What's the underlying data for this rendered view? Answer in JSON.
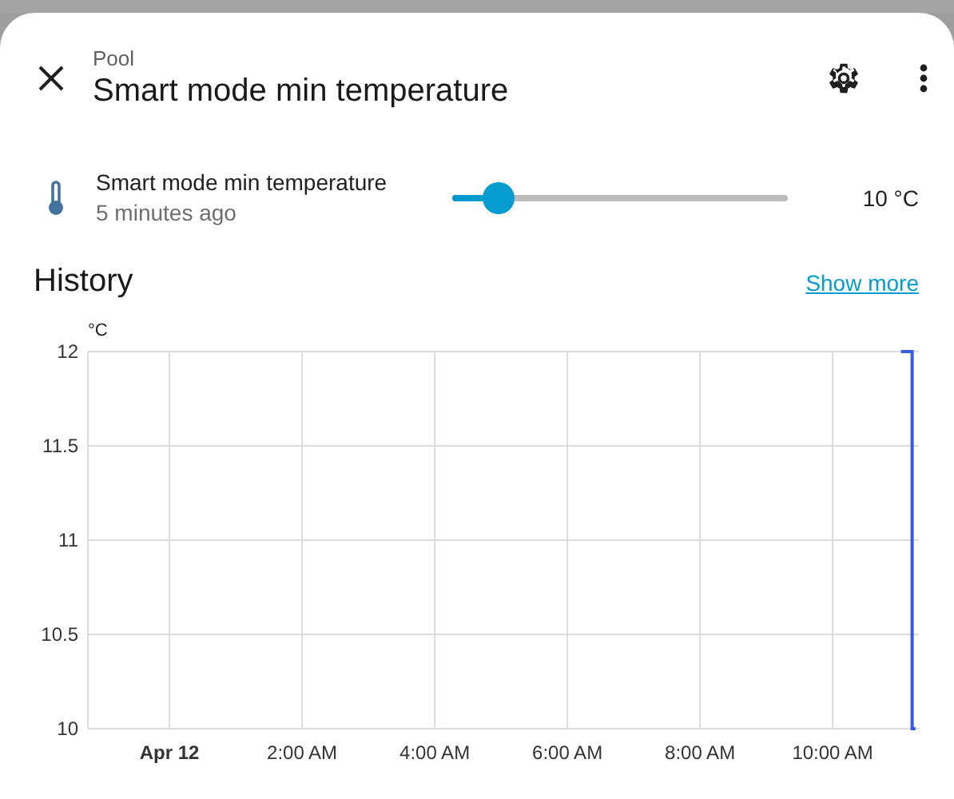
{
  "dialog": {
    "breadcrumb": "Pool",
    "title": "Smart mode min temperature"
  },
  "entity": {
    "name": "Smart mode min temperature",
    "last_changed": "5 minutes ago",
    "level": 0.14,
    "reading": "10 °C"
  },
  "history": {
    "title": "History",
    "link": "Show more",
    "chart_data": {
      "type": "line",
      "ylabel": "°C",
      "xlim": [
        -1.23,
        11.3
      ],
      "ylim": [
        10,
        12
      ],
      "xticks": [
        {
          "value": 0,
          "label": "Apr 12"
        },
        {
          "value": 2,
          "label": "2:00 AM"
        },
        {
          "value": 4,
          "label": "4:00 AM"
        },
        {
          "value": 6,
          "label": "6:00 AM"
        },
        {
          "value": 8,
          "label": "8:00 AM"
        },
        {
          "value": 10,
          "label": "10:00 AM"
        }
      ],
      "yticks": [
        10,
        10.5,
        11,
        11.5,
        12
      ],
      "grid": true,
      "x": [
        11.03,
        11.2,
        11.2,
        11.25
      ],
      "series": [
        {
          "color": "#3b5bdb",
          "values": [
            12,
            12,
            10,
            10
          ]
        }
      ]
    }
  }
}
